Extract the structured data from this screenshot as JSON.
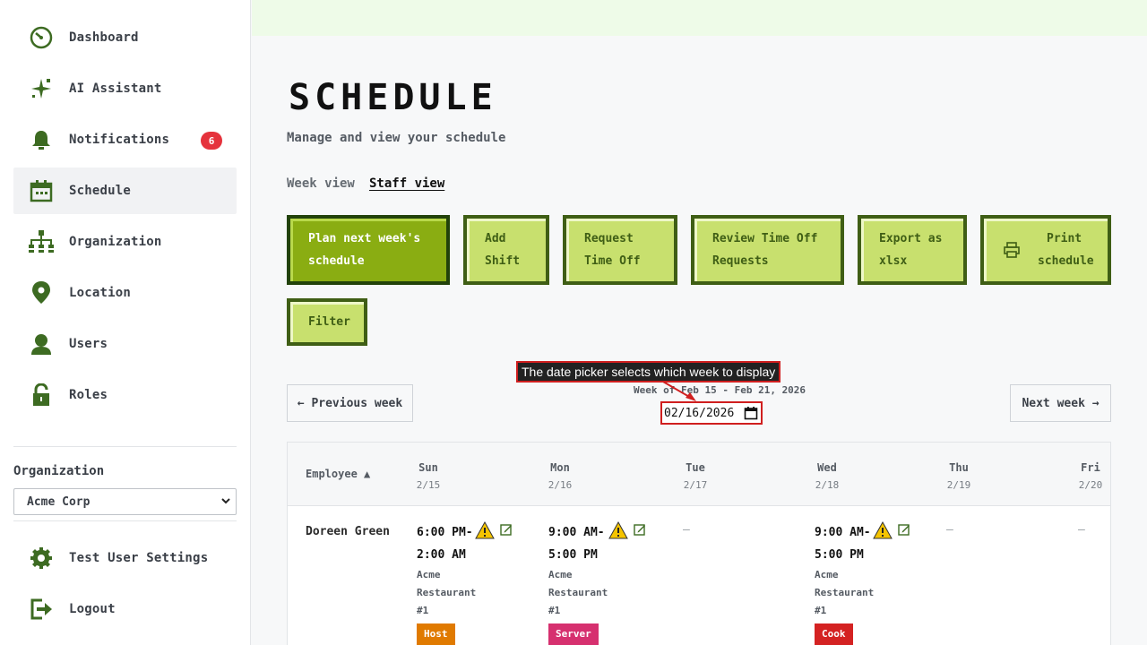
{
  "sidebar": {
    "items": [
      {
        "label": "Dashboard",
        "icon": "dashboard-icon"
      },
      {
        "label": "AI Assistant",
        "icon": "sparkle-icon"
      },
      {
        "label": "Notifications",
        "icon": "bell-icon",
        "badge": "6"
      },
      {
        "label": "Schedule",
        "icon": "calendar-icon",
        "active": true
      },
      {
        "label": "Organization",
        "icon": "org-chart-icon"
      },
      {
        "label": "Location",
        "icon": "location-pin-icon"
      },
      {
        "label": "Users",
        "icon": "user-icon"
      },
      {
        "label": "Roles",
        "icon": "lock-icon"
      }
    ],
    "org_label": "Organization",
    "org_selected": "Acme Corp",
    "bottom_items": [
      {
        "label": "Test User Settings",
        "icon": "gear-icon"
      },
      {
        "label": "Logout",
        "icon": "logout-icon"
      }
    ]
  },
  "main": {
    "title": "SCHEDULE",
    "subtitle": "Manage and view your schedule",
    "view_tabs": {
      "week": "Week view",
      "staff": "Staff view"
    },
    "actions": {
      "plan_line1": "Plan next week's",
      "plan_line2": "schedule",
      "add_line1": "Add",
      "add_line2": "Shift",
      "request_line1": "Request",
      "request_line2": "Time Off",
      "review_line1": "Review Time Off",
      "review_line2": "Requests",
      "export_line1": "Export as",
      "export_line2": "xlsx",
      "print_line1": "Print",
      "print_line2": "schedule",
      "filter": "Filter"
    },
    "callout": "The date picker selects which week to display",
    "week_range": "Week of Feb 15 - Feb 21, 2026",
    "date_value": "02/16/2026",
    "prev_week": "← Previous week",
    "next_week": "Next week →"
  },
  "table": {
    "employee_header": "Employee ▲",
    "days": [
      {
        "name": "Sun",
        "date": "2/15"
      },
      {
        "name": "Mon",
        "date": "2/16"
      },
      {
        "name": "Tue",
        "date": "2/17"
      },
      {
        "name": "Wed",
        "date": "2/18"
      },
      {
        "name": "Thu",
        "date": "2/19"
      },
      {
        "name": "Fri",
        "date": "2/20"
      }
    ],
    "rows": [
      {
        "employee": "Doreen Green",
        "shifts": [
          {
            "time1": "6:00 PM-",
            "time2": "2:00 AM",
            "loc1": "Acme",
            "loc2": "Restaurant",
            "loc3": "#1",
            "role": "Host",
            "role_color": "#e07a00"
          },
          {
            "time1": "9:00 AM-",
            "time2": "5:00 PM",
            "loc1": "Acme",
            "loc2": "Restaurant",
            "loc3": "#1",
            "role": "Server",
            "role_color": "#d6306f"
          },
          {
            "empty": "–"
          },
          {
            "time1": "9:00 AM-",
            "time2": "5:00 PM",
            "loc1": "Acme",
            "loc2": "Restaurant",
            "loc3": "#1",
            "role": "Cook",
            "role_color": "#d42222"
          },
          {
            "empty": "–"
          },
          {
            "empty": "–"
          }
        ]
      }
    ]
  },
  "colors": {
    "accent_green": "#8aad12",
    "button_light": "#c8e06e",
    "button_border": "#3f5e15",
    "badge_red": "#e5323c"
  }
}
